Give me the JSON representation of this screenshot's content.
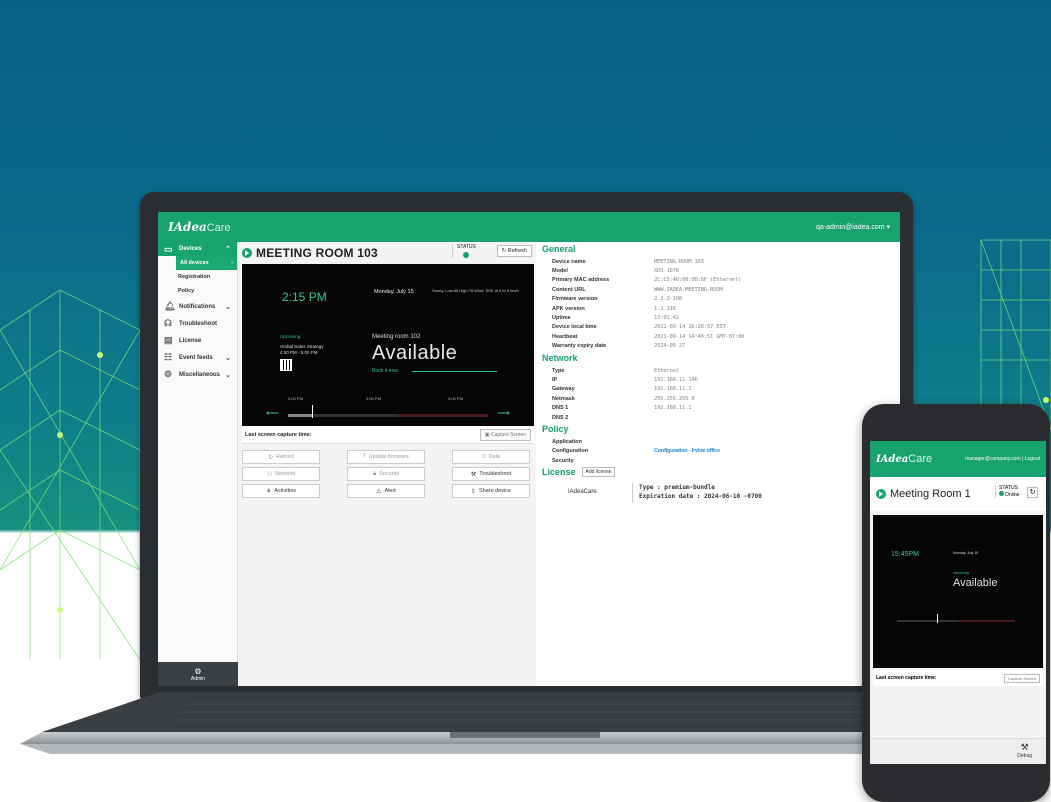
{
  "app": {
    "logo_main": "IAdea",
    "logo_sub": "Care",
    "user": "qa-admin@iadea.com ▾"
  },
  "sidebar": {
    "devices_label": "Devices",
    "sub_items": [
      "All devices",
      "Registration",
      "Policy"
    ],
    "items": [
      "Notifications",
      "Troubleshoot",
      "License",
      "Event feeds",
      "Miscellaneous"
    ],
    "admin_label": "Admin"
  },
  "device": {
    "title": "MEETING ROOM 103",
    "status_label": "STATUS",
    "refresh_label": "Refresh",
    "preview": {
      "time": "2:15 PM",
      "date": "Monday, July 15",
      "weather": "Sunny, Low:65 High:78 Wind: SSE at 6 to 9 km/h",
      "upcoming_label": "Upcoming",
      "upcoming_title": "Global Sales Strategy",
      "upcoming_time": "4:00 PM - 5:00 PM",
      "room": "Meeting room 102",
      "availability": "Available",
      "book_label": "Book it now",
      "ticks": [
        "2:00 PM",
        "3:00 PM",
        "4:00 PM"
      ]
    },
    "capture_label": "Last screen capture time:",
    "capture_button": "Capture Screen",
    "actions": [
      {
        "label": "Reboot",
        "icon": "↻",
        "dim": true
      },
      {
        "label": "Update firmware",
        "icon": "⤒",
        "dim": true
      },
      {
        "label": "Data",
        "icon": "≡",
        "dim": true
      },
      {
        "label": "Network",
        "icon": "⚇",
        "dim": true
      },
      {
        "label": "Security",
        "icon": "🔒︎",
        "dim": true
      },
      {
        "label": "Troubleshoot",
        "icon": "⚒",
        "dim": false
      },
      {
        "label": "Activities",
        "icon": "⚘",
        "dim": false
      },
      {
        "label": "Alert",
        "icon": "⚠",
        "dim": false
      },
      {
        "label": "Share device",
        "icon": "⇪",
        "dim": false
      }
    ]
  },
  "details": {
    "general_title": "General",
    "general": [
      {
        "k": "Device name",
        "v": "MEETING ROOM 103"
      },
      {
        "k": "Model",
        "v": "XDS-1078"
      },
      {
        "k": "Primary MAC address",
        "v": "2C:C5:40:00:0D:6F (Ethernet)"
      },
      {
        "k": "Content URL",
        "v": "WWW.IADEA.MEETING.ROOM"
      },
      {
        "k": "Firmware version",
        "v": "2.2.2-108"
      },
      {
        "k": "APK version",
        "v": "1.1.116"
      },
      {
        "k": "Uptime",
        "v": "13:01:42"
      },
      {
        "k": "Device local time",
        "v": "2021-09-14 16:28:57 EST"
      },
      {
        "k": "Heartbeat",
        "v": "2021-09-14 14:46:51 GMT-07:00"
      },
      {
        "k": "Warranty expiry date",
        "v": "2024-05-27"
      }
    ],
    "network_title": "Network",
    "network": [
      {
        "k": "Type",
        "v": "Ethernet"
      },
      {
        "k": "IP",
        "v": "192.168.11.146"
      },
      {
        "k": "Gateway",
        "v": "192.168.11.1"
      },
      {
        "k": "Netmask",
        "v": "255.255.255.0"
      },
      {
        "k": "DNS 1",
        "v": "192.168.11.1"
      },
      {
        "k": "DNS 2",
        "v": ""
      }
    ],
    "policy_title": "Policy",
    "policy": [
      {
        "k": "Application",
        "v": ""
      },
      {
        "k": "Configuration",
        "v": "Configuration - Irvine office"
      },
      {
        "k": "Security",
        "v": ""
      }
    ],
    "license_title": "License",
    "add_license": "Add license",
    "license_name": "IAdeaCare",
    "license_type": "Type : premium-bundle",
    "license_exp": "Expiration date : 2024-06-10 -0700"
  },
  "phone": {
    "user": "manager@company.com | Logout",
    "title": "Meeting Room 1",
    "status_label": "STATUS",
    "status_value": "Online",
    "time": "15:45PM",
    "date": "Monday, July 15",
    "upcoming_label": "Upcoming",
    "availability": "Available",
    "capture_label": "Last screen capture time:",
    "capture_button": "Capture Screen",
    "debug_label": "Debug"
  },
  "colors": {
    "accent": "#17a270",
    "link": "#2a8cd8",
    "busy": "#4b1a1a"
  }
}
